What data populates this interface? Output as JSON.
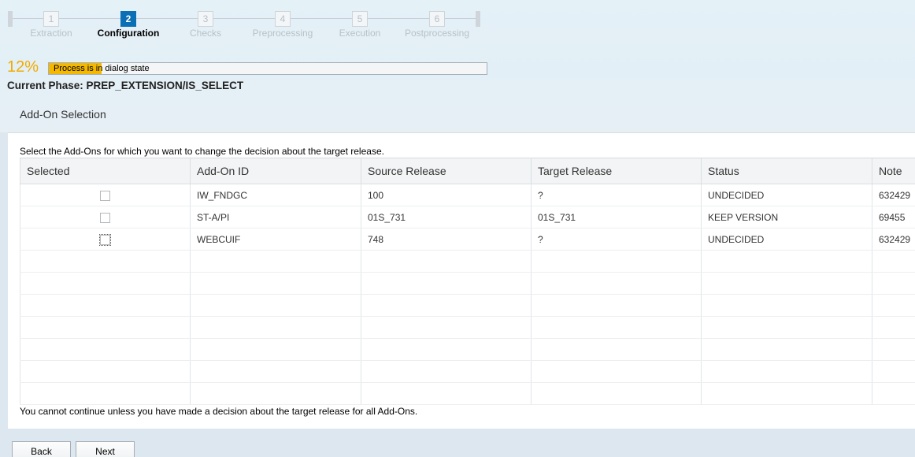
{
  "roadmap": {
    "steps": [
      {
        "num": "1",
        "label": "Extraction"
      },
      {
        "num": "2",
        "label": "Configuration"
      },
      {
        "num": "3",
        "label": "Checks"
      },
      {
        "num": "4",
        "label": "Preprocessing"
      },
      {
        "num": "5",
        "label": "Execution"
      },
      {
        "num": "6",
        "label": "Postprocessing"
      }
    ],
    "active_step": 2
  },
  "progress": {
    "percent_label": "12%",
    "value": 0.12,
    "status_text": "Process is in dialog state"
  },
  "phase": {
    "label": "Current Phase: PREP_EXTENSION/IS_SELECT"
  },
  "panel": {
    "title": "Add-On Selection",
    "instruction": "Select the Add-Ons for which you want to change the decision about the target release.",
    "note": "You cannot continue unless you have made a decision about the target release for all Add-Ons."
  },
  "table": {
    "columns": [
      "Selected",
      "Add-On ID",
      "Source Release",
      "Target Release",
      "Status",
      "Note"
    ],
    "rows": [
      {
        "selected": false,
        "addon_id": "IW_FNDGC",
        "source": "100",
        "target": "?",
        "status": "UNDECIDED",
        "note": "632429"
      },
      {
        "selected": false,
        "addon_id": "ST-A/PI",
        "source": "01S_731",
        "target": "01S_731",
        "status": "KEEP VERSION",
        "note": "69455"
      },
      {
        "selected": false,
        "addon_id": "WEBCUIF",
        "source": "748",
        "target": "?",
        "status": "UNDECIDED",
        "note": "632429"
      }
    ],
    "empty_rows": 7
  },
  "buttons": {
    "back": "Back",
    "next": "Next"
  },
  "colors": {
    "accent": "#0b6fb6",
    "progress": "#f5b800",
    "percent": "#f0ab00"
  }
}
